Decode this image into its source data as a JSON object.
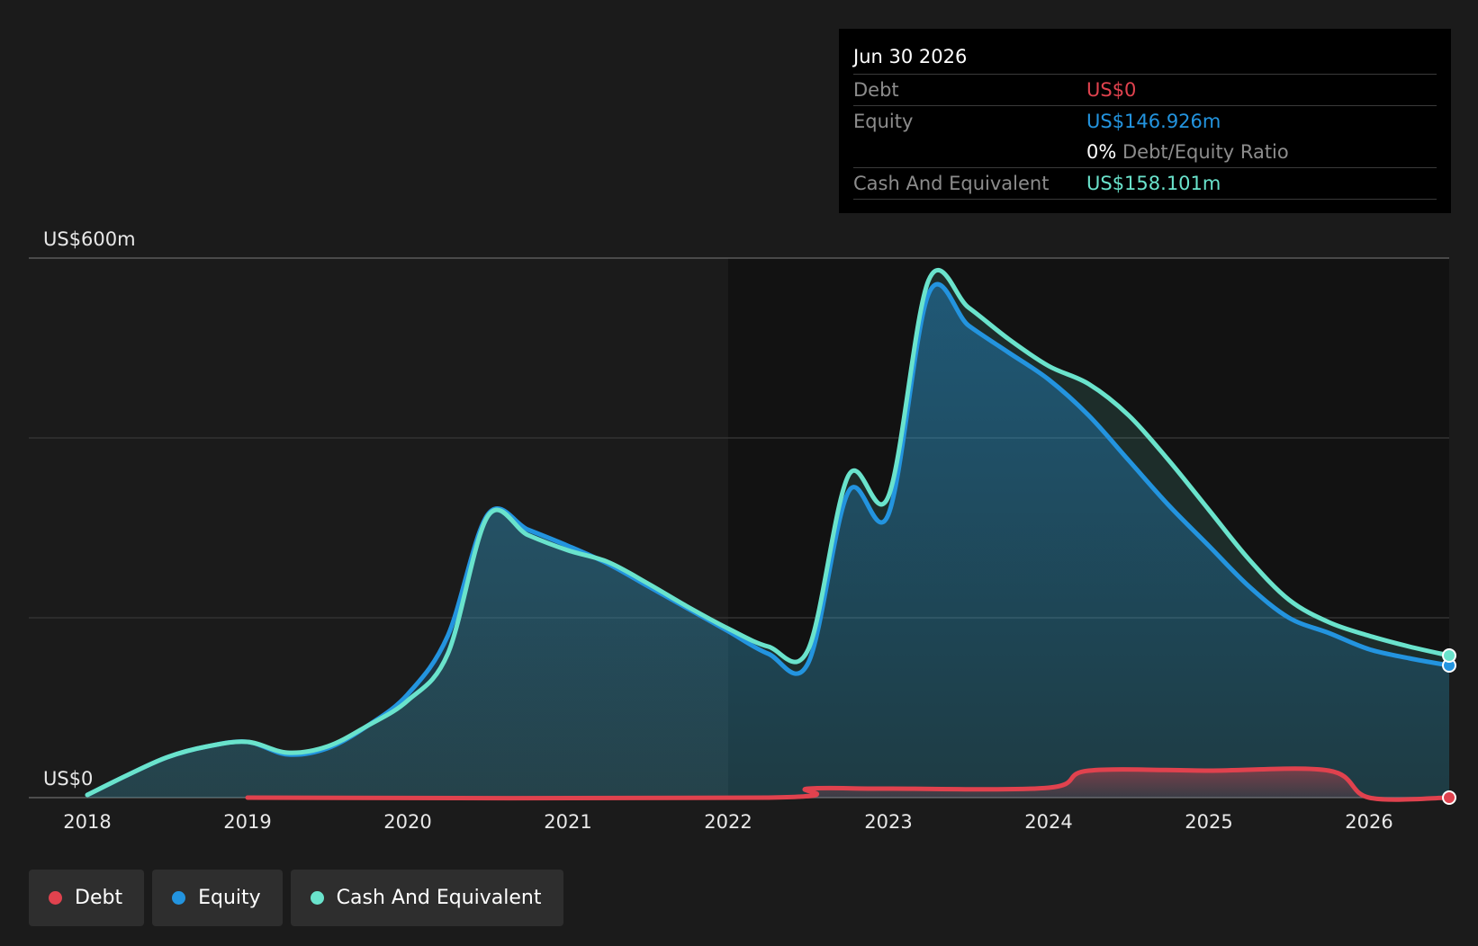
{
  "tooltip": {
    "date": "Jun 30 2026",
    "debt_label": "Debt",
    "debt_value": "US$0",
    "equity_label": "Equity",
    "equity_value": "US$146.926m",
    "ratio_value": "0%",
    "ratio_label": "Debt/Equity Ratio",
    "cash_label": "Cash And Equivalent",
    "cash_value": "US$158.101m"
  },
  "legend": {
    "debt": "Debt",
    "equity": "Equity",
    "cash": "Cash And Equivalent"
  },
  "colors": {
    "debt": "#e0424e",
    "equity": "#2394df",
    "cash": "#6ae3cc",
    "background": "#1b1b1b"
  },
  "chart_data": {
    "type": "area",
    "ylim": [
      0,
      600
    ],
    "y_tick_labels": [
      {
        "value": 600,
        "label": "US$600m"
      },
      {
        "value": 0,
        "label": "US$0"
      }
    ],
    "x_ticks": [
      2018,
      2019,
      2020,
      2021,
      2022,
      2023,
      2024,
      2025,
      2026
    ],
    "xlim": [
      2018,
      2026.5
    ],
    "series": [
      {
        "name": "Debt",
        "key": "debt",
        "points": [
          [
            2019,
            0
          ],
          [
            2022.25,
            0
          ],
          [
            2022.5,
            10
          ],
          [
            2023,
            10
          ],
          [
            2024,
            11
          ],
          [
            2024.25,
            30
          ],
          [
            2025,
            30
          ],
          [
            2025.75,
            30
          ],
          [
            2026,
            0
          ],
          [
            2026.5,
            0
          ]
        ]
      },
      {
        "name": "Equity",
        "key": "equity",
        "points": [
          [
            2018,
            3
          ],
          [
            2018.25,
            25
          ],
          [
            2018.5,
            45
          ],
          [
            2018.75,
            57
          ],
          [
            2019,
            62
          ],
          [
            2019.25,
            48
          ],
          [
            2019.5,
            55
          ],
          [
            2019.75,
            80
          ],
          [
            2020,
            115
          ],
          [
            2020.25,
            180
          ],
          [
            2020.5,
            315
          ],
          [
            2020.75,
            298
          ],
          [
            2021,
            280
          ],
          [
            2021.25,
            260
          ],
          [
            2021.5,
            235
          ],
          [
            2021.75,
            210
          ],
          [
            2022,
            185
          ],
          [
            2022.25,
            160
          ],
          [
            2022.5,
            150
          ],
          [
            2022.75,
            340
          ],
          [
            2023,
            315
          ],
          [
            2023.25,
            560
          ],
          [
            2023.5,
            525
          ],
          [
            2023.75,
            495
          ],
          [
            2024,
            465
          ],
          [
            2024.25,
            425
          ],
          [
            2024.5,
            375
          ],
          [
            2024.75,
            325
          ],
          [
            2025,
            280
          ],
          [
            2025.25,
            235
          ],
          [
            2025.5,
            200
          ],
          [
            2025.75,
            183
          ],
          [
            2026,
            165
          ],
          [
            2026.25,
            155
          ],
          [
            2026.5,
            147
          ]
        ]
      },
      {
        "name": "Cash And Equivalent",
        "key": "cash",
        "points": [
          [
            2018,
            3
          ],
          [
            2018.25,
            25
          ],
          [
            2018.5,
            45
          ],
          [
            2018.75,
            57
          ],
          [
            2019,
            62
          ],
          [
            2019.25,
            50
          ],
          [
            2019.5,
            57
          ],
          [
            2019.75,
            80
          ],
          [
            2020,
            108
          ],
          [
            2020.25,
            160
          ],
          [
            2020.5,
            313
          ],
          [
            2020.75,
            292
          ],
          [
            2021,
            275
          ],
          [
            2021.25,
            262
          ],
          [
            2021.5,
            238
          ],
          [
            2021.75,
            212
          ],
          [
            2022,
            188
          ],
          [
            2022.25,
            168
          ],
          [
            2022.5,
            165
          ],
          [
            2022.75,
            358
          ],
          [
            2023,
            335
          ],
          [
            2023.25,
            575
          ],
          [
            2023.5,
            545
          ],
          [
            2023.75,
            510
          ],
          [
            2024,
            480
          ],
          [
            2024.25,
            460
          ],
          [
            2024.5,
            425
          ],
          [
            2024.75,
            375
          ],
          [
            2025,
            320
          ],
          [
            2025.25,
            265
          ],
          [
            2025.5,
            220
          ],
          [
            2025.75,
            195
          ],
          [
            2026,
            180
          ],
          [
            2026.25,
            168
          ],
          [
            2026.5,
            158
          ]
        ]
      }
    ]
  }
}
